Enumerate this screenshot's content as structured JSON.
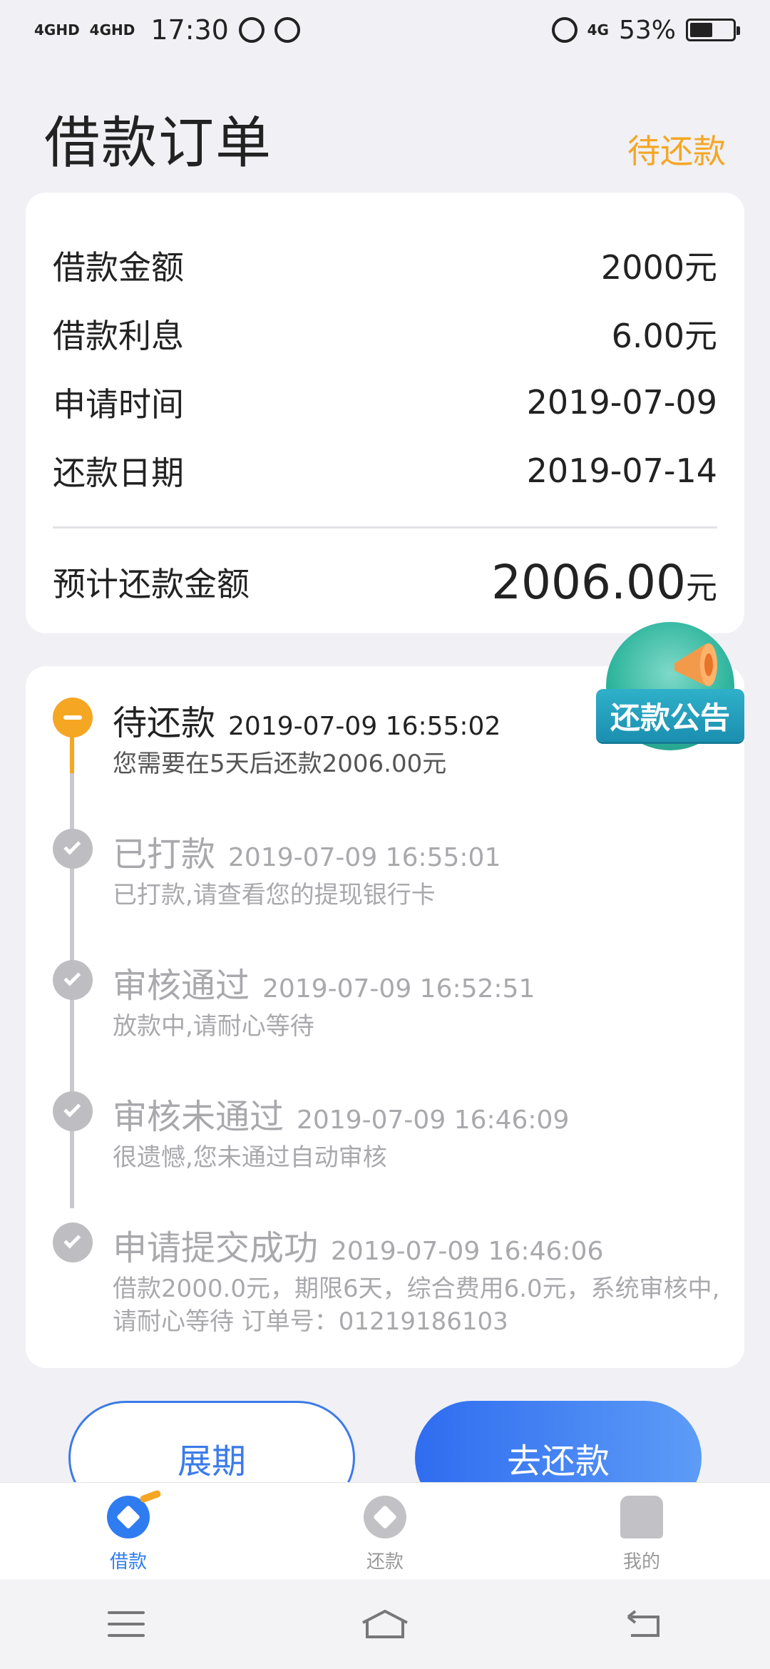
{
  "status_bar": {
    "network1": "4GHD",
    "network2": "4GHD",
    "time": "17:30",
    "network3": "4G",
    "battery": "53%",
    "battery_level": 0.53
  },
  "header": {
    "title": "借款订单",
    "status": "待还款"
  },
  "summary": {
    "rows": [
      {
        "label": "借款金额",
        "value": "2000元"
      },
      {
        "label": "借款利息",
        "value": "6.00元"
      },
      {
        "label": "申请时间",
        "value": "2019-07-09"
      },
      {
        "label": "还款日期",
        "value": "2019-07-14"
      }
    ],
    "total_label": "预计还款金额",
    "total_amount": "2006.00",
    "total_unit": "元"
  },
  "notice": {
    "label": "还款公告"
  },
  "timeline": [
    {
      "title": "待还款",
      "time": "2019-07-09 16:55:02",
      "desc": "您需要在5天后还款2006.00元",
      "active": true
    },
    {
      "title": "已打款",
      "time": "2019-07-09 16:55:01",
      "desc": "已打款,请查看您的提现银行卡",
      "active": false
    },
    {
      "title": "审核通过",
      "time": "2019-07-09 16:52:51",
      "desc": "放款中,请耐心等待",
      "active": false
    },
    {
      "title": "审核未通过",
      "time": "2019-07-09 16:46:09",
      "desc": "很遗憾,您未通过自动审核",
      "active": false
    },
    {
      "title": "申请提交成功",
      "time": "2019-07-09 16:46:06",
      "desc": "借款2000.0元，期限6天，综合费用6.0元，系统审核中,请耐心等待 订单号：01219186103",
      "active": false
    }
  ],
  "actions": {
    "extend_label": "展期",
    "repay_label": "去还款"
  },
  "tabs": [
    {
      "label": "借款",
      "icon": "loan-icon",
      "active": true
    },
    {
      "label": "还款",
      "icon": "repay-icon",
      "active": false
    },
    {
      "label": "我的",
      "icon": "profile-icon",
      "active": false
    }
  ],
  "colors": {
    "accent_orange": "#f5a623",
    "primary_blue": "#2f7cf0",
    "notice_teal": "#2fb59d"
  }
}
